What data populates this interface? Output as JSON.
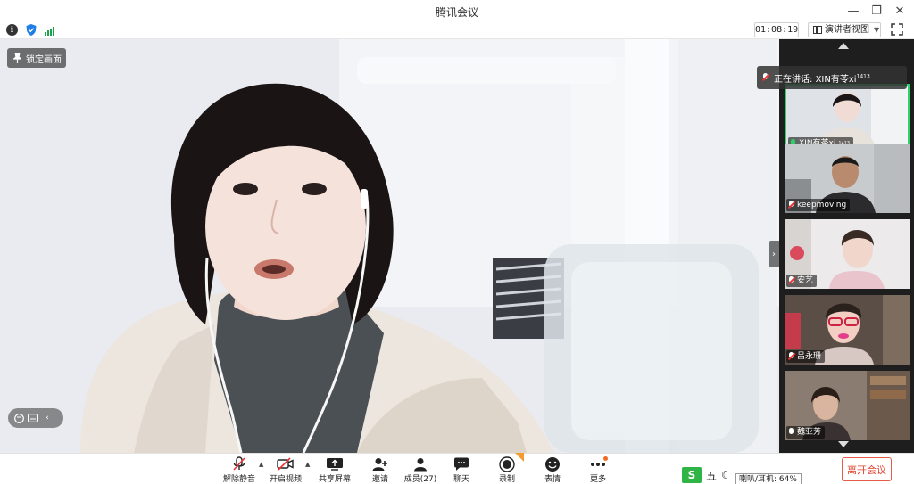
{
  "window": {
    "title": "腾讯会议"
  },
  "infobar": {
    "timer": "01:08:19",
    "view_label": "演讲者视图"
  },
  "main": {
    "lock_label": "锁定画面"
  },
  "speaking": {
    "prefix": "正在讲话: ",
    "name": "XIN有苓xi",
    "name_sup": "1413"
  },
  "gallery": {
    "tiles": [
      {
        "name": "XIN有苓xi",
        "sup": "1413",
        "mic": "active"
      },
      {
        "name": "keepmoving",
        "sup": "",
        "mic": "muted"
      },
      {
        "name": "安艺",
        "sup": "",
        "mic": "muted"
      },
      {
        "name": "吕永珊",
        "sup": "",
        "mic": "muted"
      },
      {
        "name": "魏亚芳",
        "sup": "",
        "mic": "on"
      }
    ]
  },
  "toolbar": {
    "unmute": "解除静音",
    "start_video": "开启视频",
    "share_screen": "共享屏幕",
    "invite": "邀请",
    "members": "成员(27)",
    "chat": "聊天",
    "record": "录制",
    "reaction": "表情",
    "more": "更多",
    "leave": "离开会议"
  },
  "ime": {
    "char": "五",
    "volume_tip": "喇叭/耳机: 64%"
  },
  "colors": {
    "accent_green": "#2bd16a",
    "leave_red": "#e0402c",
    "gallery_bg": "#1e1e1e"
  }
}
